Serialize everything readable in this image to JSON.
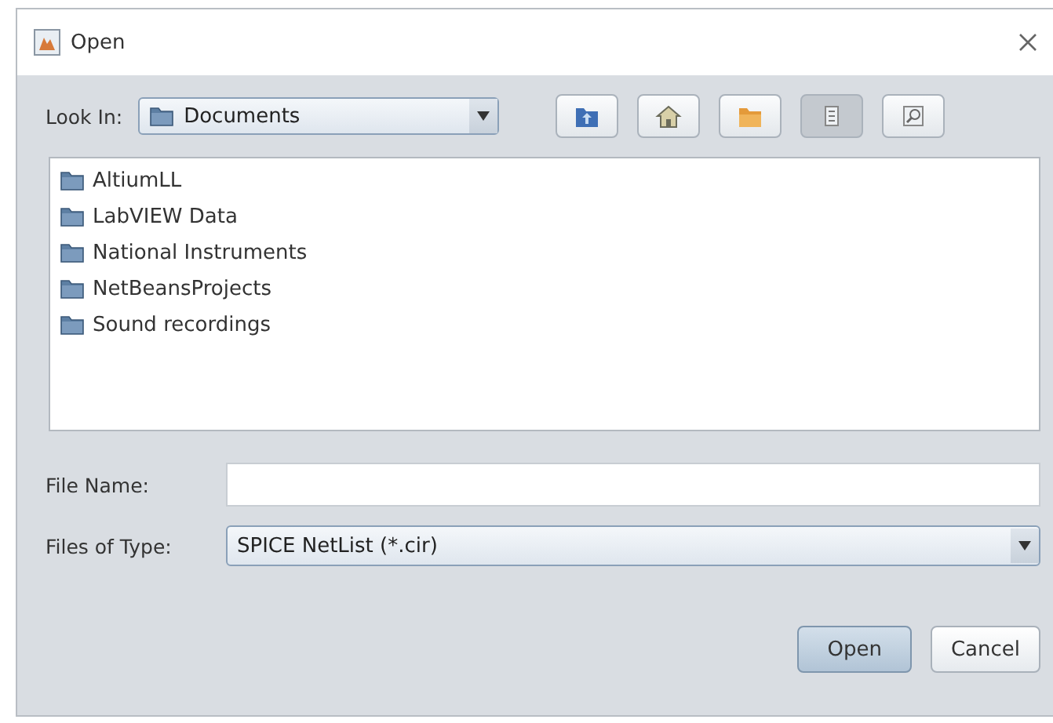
{
  "window": {
    "title": "Open"
  },
  "look_in": {
    "label": "Look In:",
    "value": "Documents"
  },
  "toolbar": [
    {
      "kind": "up",
      "selected": false
    },
    {
      "kind": "home",
      "selected": false
    },
    {
      "kind": "new-folder",
      "selected": false
    },
    {
      "kind": "list",
      "selected": true
    },
    {
      "kind": "details",
      "selected": false
    }
  ],
  "files": [
    {
      "name": "AltiumLL"
    },
    {
      "name": "LabVIEW Data"
    },
    {
      "name": "National Instruments"
    },
    {
      "name": "NetBeansProjects"
    },
    {
      "name": "Sound recordings"
    }
  ],
  "file_name": {
    "label": "File Name:"
  },
  "file_type": {
    "label": "Files of Type:",
    "value": "SPICE NetList (*.cir)"
  },
  "buttons": [
    {
      "label": "Open",
      "default": true
    },
    {
      "label": "Cancel",
      "default": false
    }
  ]
}
